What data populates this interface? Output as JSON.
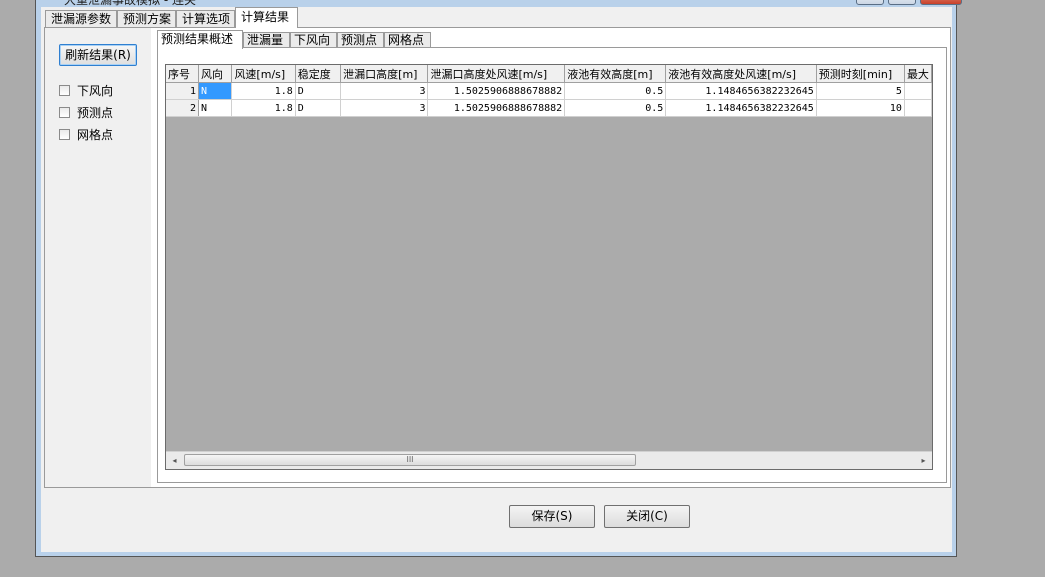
{
  "window": {
    "title": "大重泄漏事故模拟 - 连关",
    "minimize_glyph": "—",
    "maximize_glyph": "□",
    "close_glyph": "✕"
  },
  "top_tabs": [
    {
      "label": "泄漏源参数"
    },
    {
      "label": "预测方案"
    },
    {
      "label": "计算选项"
    },
    {
      "label": "计算结果"
    }
  ],
  "left": {
    "refresh_label": "刷新结果(R)",
    "checkboxes": [
      {
        "label": "下风向",
        "checked": false
      },
      {
        "label": "预测点",
        "checked": false
      },
      {
        "label": "网格点",
        "checked": false
      }
    ]
  },
  "inner_tabs": [
    {
      "label": "预测结果概述"
    },
    {
      "label": "泄漏量"
    },
    {
      "label": "下风向"
    },
    {
      "label": "预测点"
    },
    {
      "label": "网格点"
    }
  ],
  "grid": {
    "headers": [
      "序号",
      "风向",
      "风速[m/s]",
      "稳定度",
      "泄漏口高度[m]",
      "泄漏口高度处风速[m/s]",
      "液池有效高度[m]",
      "液池有效高度处风速[m/s]",
      "预测时刻[min]",
      "最大"
    ],
    "rows": [
      [
        "1",
        "N",
        "1.8",
        "D",
        "3",
        "1.5025906888678882",
        "0.5",
        "1.1484656382232645",
        "5",
        ""
      ],
      [
        "2",
        "N",
        "1.8",
        "D",
        "3",
        "1.5025906888678882",
        "0.5",
        "1.1484656382232645",
        "10",
        ""
      ]
    ],
    "scroll_left": "◂",
    "scroll_right": "▸",
    "thumb_grip": "III"
  },
  "buttons": {
    "save": "保存(S)",
    "close": "关闭(C)"
  }
}
